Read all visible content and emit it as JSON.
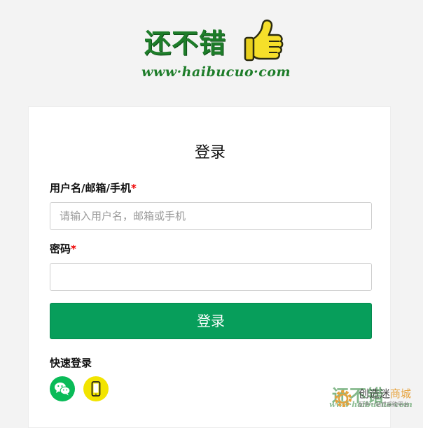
{
  "logo": {
    "brand_cn": "还不错",
    "brand_url": "www·haibucuo·com",
    "icon": "thumbs-up-icon"
  },
  "login": {
    "title": "登录",
    "username_label": "用户名/邮箱/手机",
    "username_placeholder": "请输入用户名，邮箱或手机",
    "password_label": "密码",
    "password_value": "",
    "required_mark": "*",
    "submit_label": "登录",
    "quick_login_label": "快速登录",
    "quick_login_icons": [
      "wechat-icon",
      "mobile-phone-icon"
    ]
  },
  "watermark": {
    "brand_cn": "还不错",
    "brand_url": "www·haibucuo·com",
    "site_name_prefix": "创造迷",
    "site_name_accent": "商城",
    "tagline": "配件一站式采购平台"
  },
  "colors": {
    "primary_green": "#079e5b",
    "wechat_green": "#09bb58",
    "mobile_yellow": "#f2e400",
    "required_red": "#e00000",
    "brand_green": "#1e7d2a"
  }
}
